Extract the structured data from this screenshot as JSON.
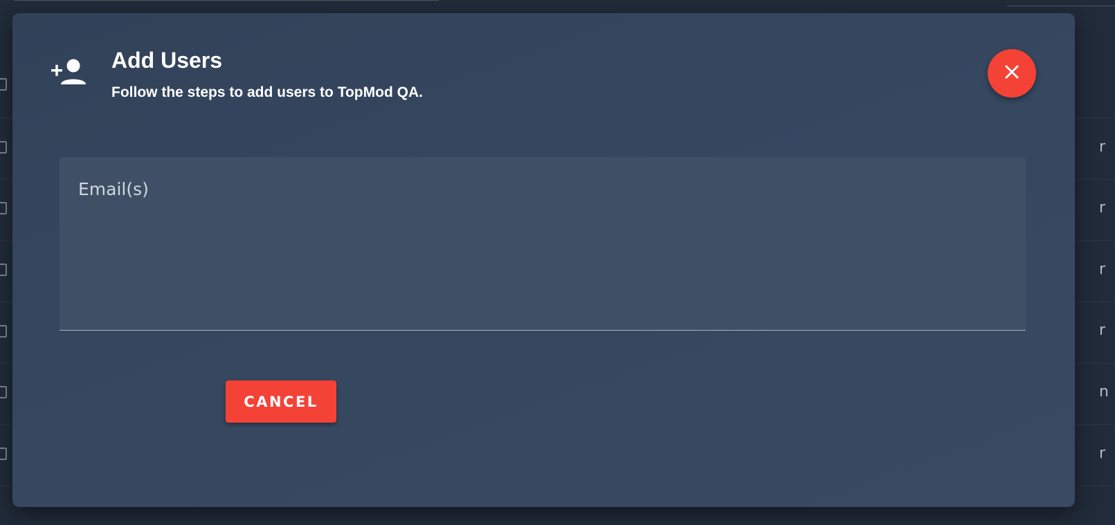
{
  "dialog": {
    "title": "Add Users",
    "subtitle": "Follow the steps to add users to TopMod QA.",
    "header_icon": "person-add-icon",
    "close_icon": "close-icon",
    "email_label": "Email(s)",
    "email_value": "",
    "cancel_label": "CANCEL"
  },
  "background": {
    "right_edge_chars": [
      "r",
      "r",
      "r",
      "r",
      "n",
      "r"
    ]
  },
  "colors": {
    "accent_red": "#f44236",
    "dialog_bg": "#354660",
    "field_bg": "#3e4f66",
    "page_bg": "#212b39"
  }
}
